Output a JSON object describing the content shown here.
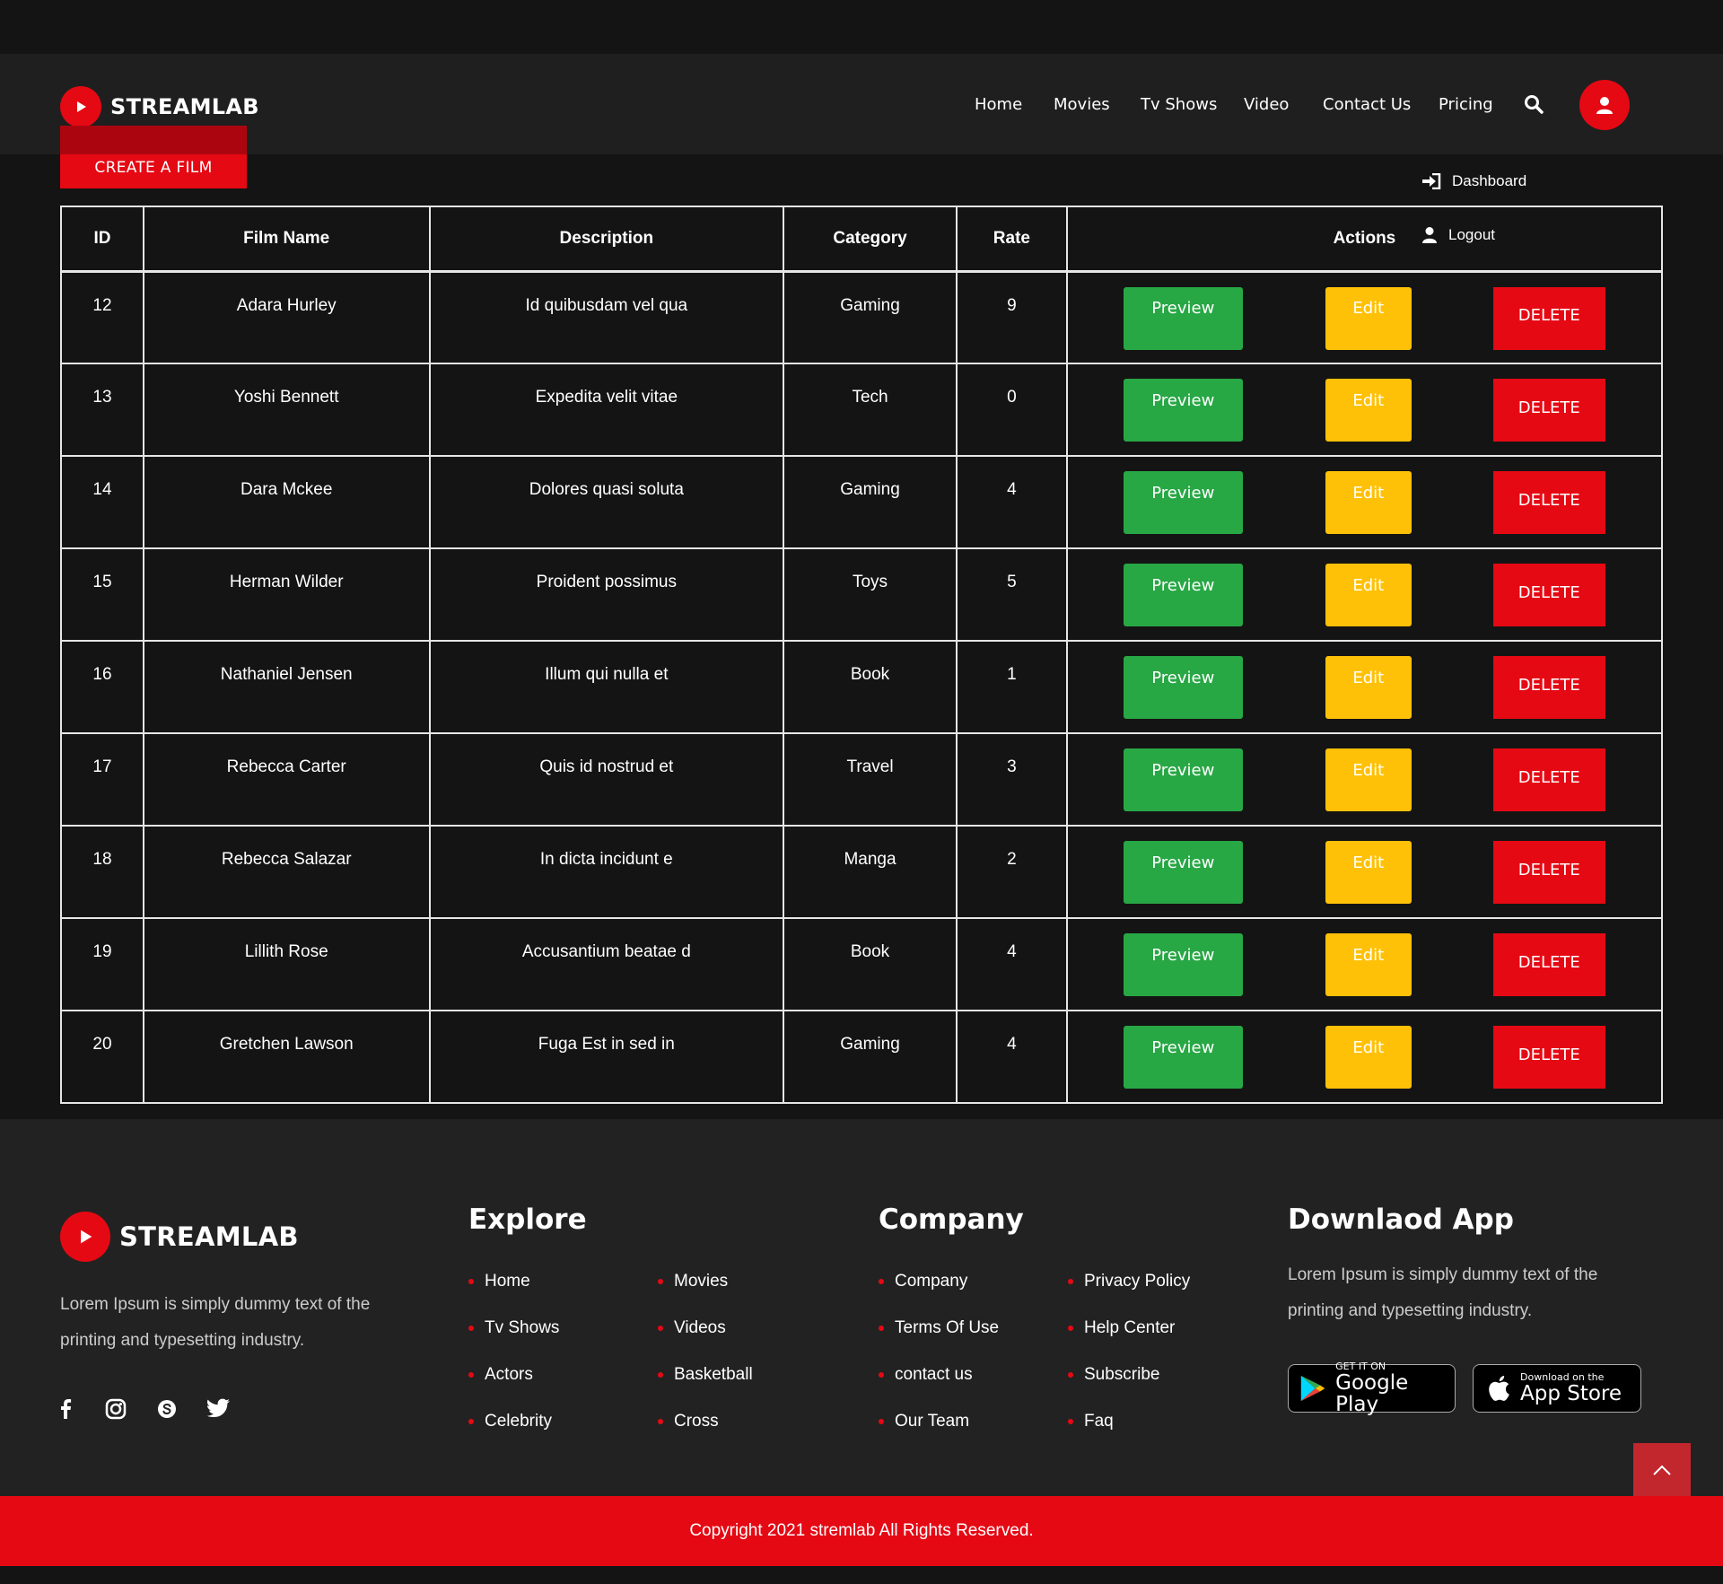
{
  "brand": {
    "name": "STREAMLAB",
    "accent": "#e50914"
  },
  "header": {
    "create_label": "CREATE A FILM",
    "nav": [
      "Home",
      "Movies",
      "Tv Shows",
      "Video",
      "Contact Us",
      "Pricing"
    ],
    "dropdown": {
      "dashboard": "Dashboard",
      "logout": "Logout"
    }
  },
  "table": {
    "columns": [
      "ID",
      "Film Name",
      "Description",
      "Category",
      "Rate",
      "Actions"
    ],
    "rows": [
      {
        "id": "12",
        "name": "Adara Hurley",
        "description": "Id quibusdam vel qua",
        "category": "Gaming",
        "rate": "9"
      },
      {
        "id": "13",
        "name": "Yoshi Bennett",
        "description": "Expedita velit vitae",
        "category": "Tech",
        "rate": "0"
      },
      {
        "id": "14",
        "name": "Dara Mckee",
        "description": "Dolores quasi soluta",
        "category": "Gaming",
        "rate": "4"
      },
      {
        "id": "15",
        "name": "Herman Wilder",
        "description": "Proident possimus",
        "category": "Toys",
        "rate": "5"
      },
      {
        "id": "16",
        "name": "Nathaniel Jensen",
        "description": "Illum qui nulla et",
        "category": "Book",
        "rate": "1"
      },
      {
        "id": "17",
        "name": "Rebecca Carter",
        "description": "Quis id nostrud et",
        "category": "Travel",
        "rate": "3"
      },
      {
        "id": "18",
        "name": "Rebecca Salazar",
        "description": "In dicta incidunt e",
        "category": "Manga",
        "rate": "2"
      },
      {
        "id": "19",
        "name": "Lillith Rose",
        "description": "Accusantium beatae d",
        "category": "Book",
        "rate": "4"
      },
      {
        "id": "20",
        "name": "Gretchen Lawson",
        "description": "Fuga Est in sed in",
        "category": "Gaming",
        "rate": "4"
      }
    ],
    "actions": {
      "preview": "Preview",
      "edit": "Edit",
      "delete": "DELETE"
    },
    "action_colors": {
      "preview": "#28a745",
      "edit": "#ffc107",
      "delete": "#e50914"
    }
  },
  "footer": {
    "about": "Lorem Ipsum is simply dummy text of the printing and typesetting industry.",
    "explore": {
      "title": "Explore",
      "links": [
        "Home",
        "Movies",
        "Tv Shows",
        "Videos",
        "Actors",
        "Basketball",
        "Celebrity",
        "Cross"
      ]
    },
    "company": {
      "title": "Company",
      "links": [
        "Company",
        "Privacy Policy",
        "Terms Of Use",
        "Help Center",
        "contact us",
        "Subscribe",
        "Our Team",
        "Faq"
      ]
    },
    "app": {
      "title": "Downlaod App",
      "text": "Lorem Ipsum is simply dummy text of the printing and typesetting industry.",
      "google": {
        "small": "GET IT ON",
        "big": "Google Play"
      },
      "apple": {
        "small": "Download on the",
        "big": "App Store"
      }
    },
    "social_icons": [
      "facebook-icon",
      "instagram-icon",
      "skype-icon",
      "twitter-icon"
    ],
    "copyright": "Copyright 2021 stremlab All Rights Reserved."
  }
}
